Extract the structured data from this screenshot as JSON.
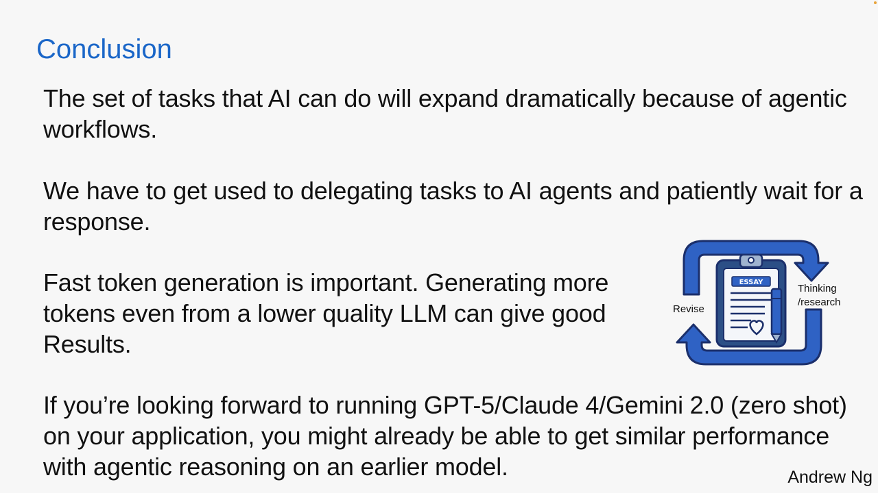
{
  "slide": {
    "title": "Conclusion",
    "paragraphs": [
      "The set of tasks that AI can do will expand dramatically because of agentic workflows.",
      "We have to get used to delegating tasks to AI agents and patiently wait for a response.",
      "Fast token generation is important. Generating more tokens even from a lower quality LLM can give good Results.",
      "If you’re looking forward to running GPT-5/Claude 4/Gemini 2.0 (zero shot) on your application, you might already be able to get similar performance with agentic reasoning on an earlier model."
    ],
    "author": "Andrew Ng"
  },
  "illustration": {
    "label_right": "Thinking\n/research",
    "label_left": "Revise",
    "card_label": "ESSAY",
    "icon": "essay-clipboard-cycle-icon"
  },
  "colors": {
    "title": "#1a66c8",
    "arrow_fill": "#2f62c4",
    "arrow_stroke": "#1b2f6b"
  }
}
